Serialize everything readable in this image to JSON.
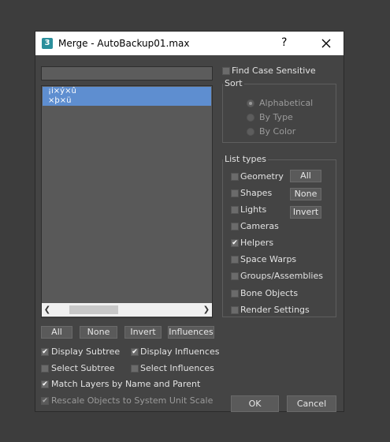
{
  "window": {
    "app_icon": "3",
    "title": "Merge - AutoBackup01.max",
    "help": "?"
  },
  "left": {
    "list_items": [
      "¡i×ý×û",
      "×þ×ü"
    ],
    "buttons": {
      "all": "All",
      "none": "None",
      "invert": "Invert",
      "influences": "Influences"
    },
    "options": {
      "display_subtree": {
        "label": "Display Subtree",
        "checked": true
      },
      "display_influences": {
        "label": "Display Influences",
        "checked": true
      },
      "select_subtree": {
        "label": "Select Subtree",
        "checked": false
      },
      "select_influences": {
        "label": "Select Influences",
        "checked": false
      },
      "match_layers": {
        "label": "Match Layers by Name and Parent",
        "checked": true
      },
      "rescale": {
        "label": "Rescale Objects to System Unit Scale",
        "checked": true,
        "disabled": true
      }
    }
  },
  "right": {
    "find_case_sensitive": {
      "label": "Find Case Sensitive",
      "checked": false
    },
    "sort": {
      "title": "Sort",
      "options": [
        {
          "label": "Alphabetical",
          "selected": true
        },
        {
          "label": "By Type",
          "selected": false
        },
        {
          "label": "By Color",
          "selected": false
        }
      ]
    },
    "list_types": {
      "title": "List types",
      "items": [
        {
          "label": "Geometry",
          "checked": false
        },
        {
          "label": "Shapes",
          "checked": false
        },
        {
          "label": "Lights",
          "checked": false
        },
        {
          "label": "Cameras",
          "checked": false
        },
        {
          "label": "Helpers",
          "checked": true
        },
        {
          "label": "Space Warps",
          "checked": false
        },
        {
          "label": "Groups/Assemblies",
          "checked": false
        },
        {
          "label": "Bone Objects",
          "checked": false
        },
        {
          "label": "Render Settings",
          "checked": false
        }
      ],
      "buttons": {
        "all": "All",
        "none": "None",
        "invert": "Invert"
      }
    },
    "ok": "OK",
    "cancel": "Cancel"
  },
  "icons": {
    "close": "close-icon",
    "scroll_left": "chevron-left-icon",
    "scroll_right": "chevron-right-icon"
  }
}
